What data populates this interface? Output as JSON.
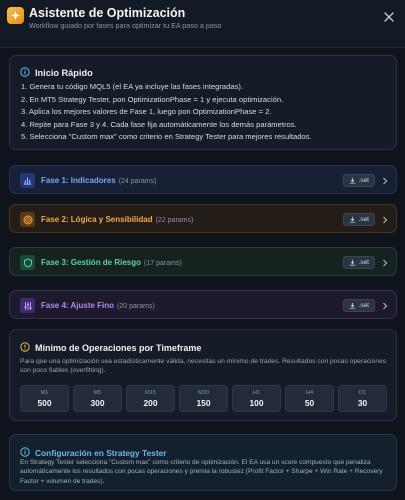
{
  "header": {
    "title": "Asistente de Optimización",
    "subtitle": "Workflow guiado por fases para optimizar tu EA paso a paso"
  },
  "quick_start": {
    "title": "Inicio Rápido",
    "steps": [
      "1. Genera tu código MQL5 (el EA ya incluye las fases integradas).",
      "2. En MT5 Strategy Tester, pon OptimizationPhase = 1 y ejecuta optimización.",
      "3. Aplica los mejores valores de Fase 1, luego pon OptimizationPhase = 2.",
      "4. Repite para Fase 3 y 4. Cada fase fija automáticamente los demás parámetros.",
      "5. Selecciona \"Custom max\" como criterio en Strategy Tester para mejores resultados."
    ]
  },
  "phases": [
    {
      "label": "Fase 1: Indicadores",
      "count": "(24 params)",
      "set_label": ".set",
      "color": "#7aa6f5"
    },
    {
      "label": "Fase 2: Lógica y Sensibilidad",
      "count": "(22 params)",
      "set_label": ".set",
      "color": "#f0a94a"
    },
    {
      "label": "Fase 3: Gestión de Riesgo",
      "count": "(17 params)",
      "set_label": ".set",
      "color": "#5fd3a5"
    },
    {
      "label": "Fase 4: Ajuste Fino",
      "count": "(20 params)",
      "set_label": ".set",
      "color": "#b18af2"
    }
  ],
  "min_ops": {
    "title": "Mínimo de Operaciones por Timeframe",
    "description": "Para que una optimización sea estadísticamente válida, necesitas un mínimo de trades. Resultados con pocas operaciones son poco fiables (overfitting).",
    "timeframes": [
      {
        "name": "M1",
        "value": "500"
      },
      {
        "name": "M5",
        "value": "300"
      },
      {
        "name": "M15",
        "value": "200"
      },
      {
        "name": "M30",
        "value": "150"
      },
      {
        "name": "H1",
        "value": "100"
      },
      {
        "name": "H4",
        "value": "50"
      },
      {
        "name": "D1",
        "value": "30"
      }
    ]
  },
  "config": {
    "title": "Configuración en Strategy Tester",
    "description": "En Strategy Tester selecciona \"Custom max\" como criterio de optimización. El EA usa un score compuesto que penaliza automáticamente los resultados con pocas operaciones y premia la robustez (Profit Factor + Sharpe + Win Rate + Recovery Factor + volumen de trades)."
  }
}
